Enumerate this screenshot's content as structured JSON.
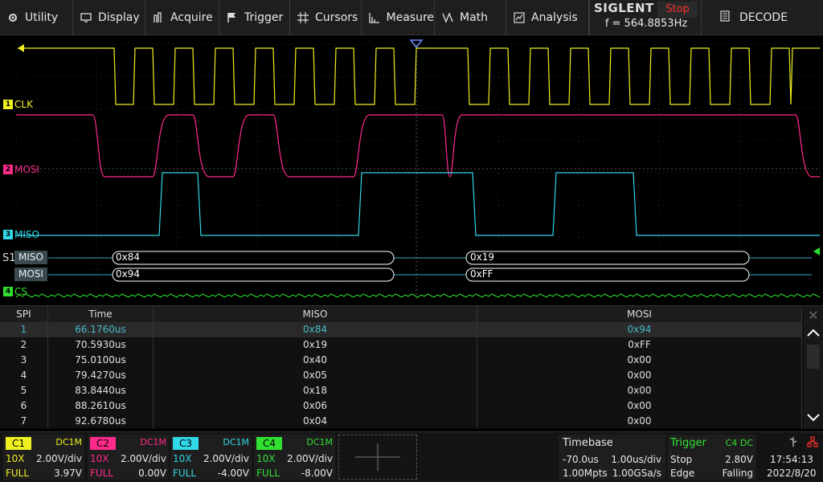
{
  "menu": {
    "items": [
      {
        "label": "Utility",
        "icon": "gear-icon"
      },
      {
        "label": "Display",
        "icon": "monitor-icon"
      },
      {
        "label": "Acquire",
        "icon": "acquire-icon"
      },
      {
        "label": "Trigger",
        "icon": "trigger-flag-icon"
      },
      {
        "label": "Cursors",
        "icon": "crosshair-icon"
      },
      {
        "label": "Measure",
        "icon": "measure-icon"
      },
      {
        "label": "Math",
        "icon": "math-icon"
      },
      {
        "label": "Analysis",
        "icon": "analysis-icon"
      }
    ],
    "brand": "SIGLENT",
    "run_state": "Stop",
    "frequency": "f = 564.8853Hz",
    "decode_label": "DECODE"
  },
  "waveform": {
    "channels": [
      {
        "id": "C1",
        "label": "CLK",
        "color": "#f0f020"
      },
      {
        "id": "C2",
        "label": "MOSI",
        "color": "#ff2a8a"
      },
      {
        "id": "C3",
        "label": "MISO",
        "color": "#30d8e8"
      },
      {
        "id": "C4",
        "label": "CS",
        "color": "#30e030"
      }
    ],
    "bus": {
      "name": "S1",
      "miso_label": "MISO",
      "mosi_label": "MOSI",
      "miso_frames": [
        "0x84",
        "0x19"
      ],
      "mosi_frames": [
        "0x94",
        "0xFF"
      ]
    }
  },
  "decode_table": {
    "headers": [
      "SPI",
      "Time",
      "MISO",
      "MOSI"
    ],
    "rows": [
      {
        "idx": "1",
        "time": "66.1760us",
        "miso": "0x84",
        "mosi": "0x94"
      },
      {
        "idx": "2",
        "time": "70.5930us",
        "miso": "0x19",
        "mosi": "0xFF"
      },
      {
        "idx": "3",
        "time": "75.0100us",
        "miso": "0x40",
        "mosi": "0x00"
      },
      {
        "idx": "4",
        "time": "79.4270us",
        "miso": "0x05",
        "mosi": "0x00"
      },
      {
        "idx": "5",
        "time": "83.8440us",
        "miso": "0x18",
        "mosi": "0x00"
      },
      {
        "idx": "6",
        "time": "88.2610us",
        "miso": "0x06",
        "mosi": "0x00"
      },
      {
        "idx": "7",
        "time": "92.6780us",
        "miso": "0x04",
        "mosi": "0x00"
      }
    ],
    "selected_row": 1
  },
  "status": {
    "channels": [
      {
        "tag": "C1",
        "color": "#f0f020",
        "coupling": "DC1M",
        "probe": "10X",
        "scale": "2.00V/div",
        "bw": "FULL",
        "offset": "3.97V"
      },
      {
        "tag": "C2",
        "color": "#ff2a8a",
        "coupling": "DC1M",
        "probe": "10X",
        "scale": "2.00V/div",
        "bw": "FULL",
        "offset": "0.00V"
      },
      {
        "tag": "C3",
        "color": "#30d8e8",
        "coupling": "DC1M",
        "probe": "10X",
        "scale": "2.00V/div",
        "bw": "FULL",
        "offset": "-4.00V"
      },
      {
        "tag": "C4",
        "color": "#30e030",
        "coupling": "DC1M",
        "probe": "10X",
        "scale": "2.00V/div",
        "bw": "FULL",
        "offset": "-8.00V"
      }
    ],
    "timebase": {
      "title": "Timebase",
      "delay": "-70.0us",
      "scale": "1.00us/div",
      "memory": "1.00Mpts",
      "rate": "1.00GSa/s"
    },
    "trigger": {
      "title": "Trigger",
      "source": "C4 DC",
      "state": "Stop",
      "level": "2.80V",
      "type": "Edge",
      "slope": "Falling"
    },
    "time": "17:54:13",
    "date": "2022/8/20"
  }
}
